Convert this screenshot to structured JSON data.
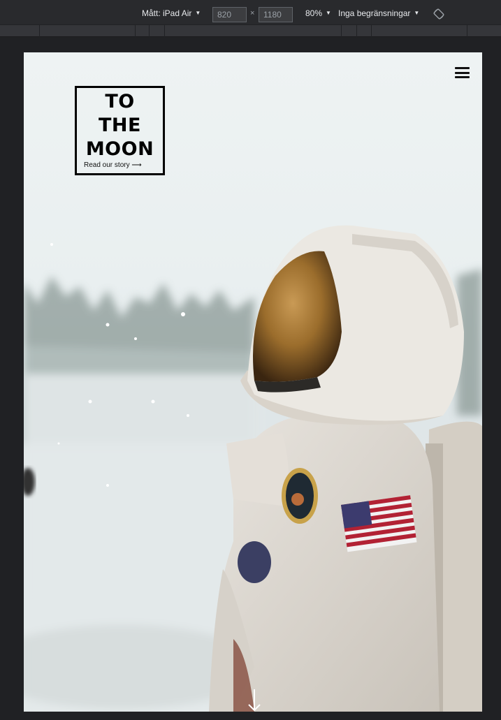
{
  "devtools": {
    "device_label": "Mått: iPad Air",
    "width_value": "820",
    "height_value": "1180",
    "dimension_separator": "×",
    "zoom_label": "80%",
    "throttle_label": "Inga begränsningar"
  },
  "page": {
    "logo_lines": [
      "TO",
      "THE",
      "MOON"
    ],
    "cta_label": "Read our story",
    "cta_arrow": "⟶"
  },
  "colors": {
    "toolbar_bg": "#292a2d",
    "ruler_bg": "#35363a",
    "canvas_bg": "#202124",
    "logo_ink": "#000000"
  },
  "icons": [
    "hamburger-menu-icon",
    "rotate-icon",
    "scroll-down-arrow-icon"
  ]
}
